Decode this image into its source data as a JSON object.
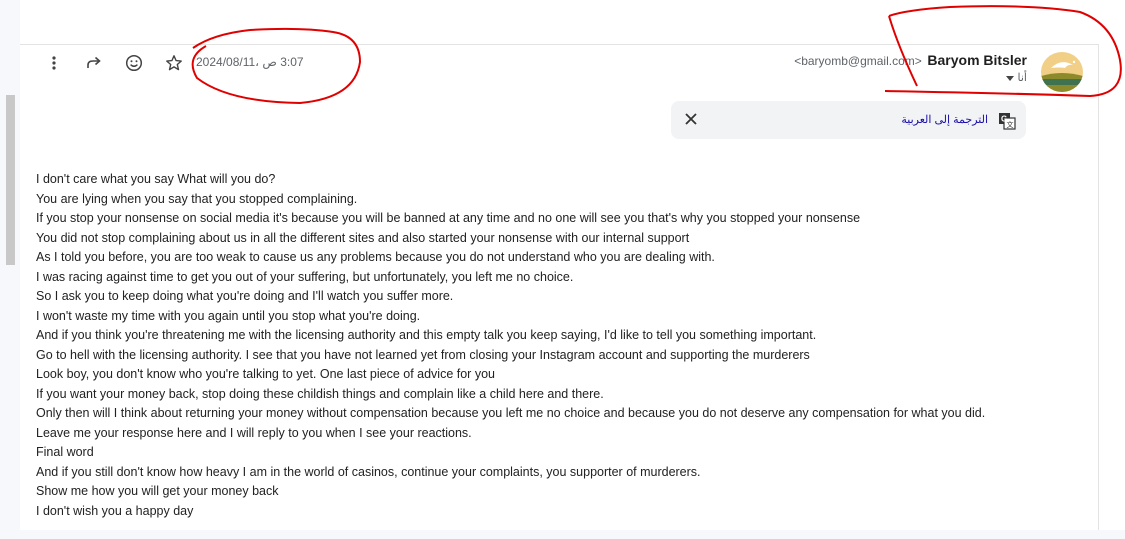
{
  "toolbar": {
    "items": [
      {
        "name": "more-options",
        "icon": "more-vert-icon"
      },
      {
        "name": "forward",
        "icon": "forward-arrow-icon"
      },
      {
        "name": "add-reaction",
        "icon": "emoji-icon"
      },
      {
        "name": "star",
        "icon": "star-icon"
      }
    ]
  },
  "message": {
    "timestamp": "3:07 ص ،2024/08/11",
    "sender_email": "<baryomb@gmail.com>",
    "sender_name": "Baryom Bitsler",
    "to_label": "أنا",
    "translate_label": "الترجمة إلى العربية",
    "body_lines": [
      "I don't care what you say What will you do?",
      "You are lying when you say that you stopped complaining.",
      "If you stop your nonsense on social media it's because you will be banned at any time and no one will see you that's why you stopped your nonsense",
      "You did not stop complaining about us in all the different sites and also started your nonsense with our internal support",
      "As I told you before, you are too weak to cause us any problems because you do not understand who you are dealing with.",
      "I was racing against time to get you out of your suffering, but unfortunately, you left me no choice.",
      "So I ask you to keep doing what you're doing and I'll watch you suffer more.",
      "I won't waste my time with you again until you stop what you're doing.",
      "And if you think you're threatening me with the licensing authority and this empty talk you keep saying, I'd like to tell you something important.",
      "Go to hell with the licensing authority. I see that you have not learned yet from closing your Instagram account and supporting the murderers",
      "Look boy, you don't know who you're talking to yet. One last piece of advice for you",
      "If you want your money back, stop doing these childish things and complain like a child here and there.",
      "Only then will I think about returning your money without compensation because you left me no choice and because you do not deserve any compensation for what you did.",
      "Leave me your response here and I will reply to you when I see your reactions.",
      "Final word",
      "And if you still don't know how heavy I am in the world of casinos, continue your complaints, you supporter of murderers.",
      "Show me how you will get your money back",
      "I don't wish you a happy day"
    ]
  },
  "colors": {
    "annotation": "#e00000",
    "link": "#1a0dab",
    "muted": "#5f6368"
  }
}
